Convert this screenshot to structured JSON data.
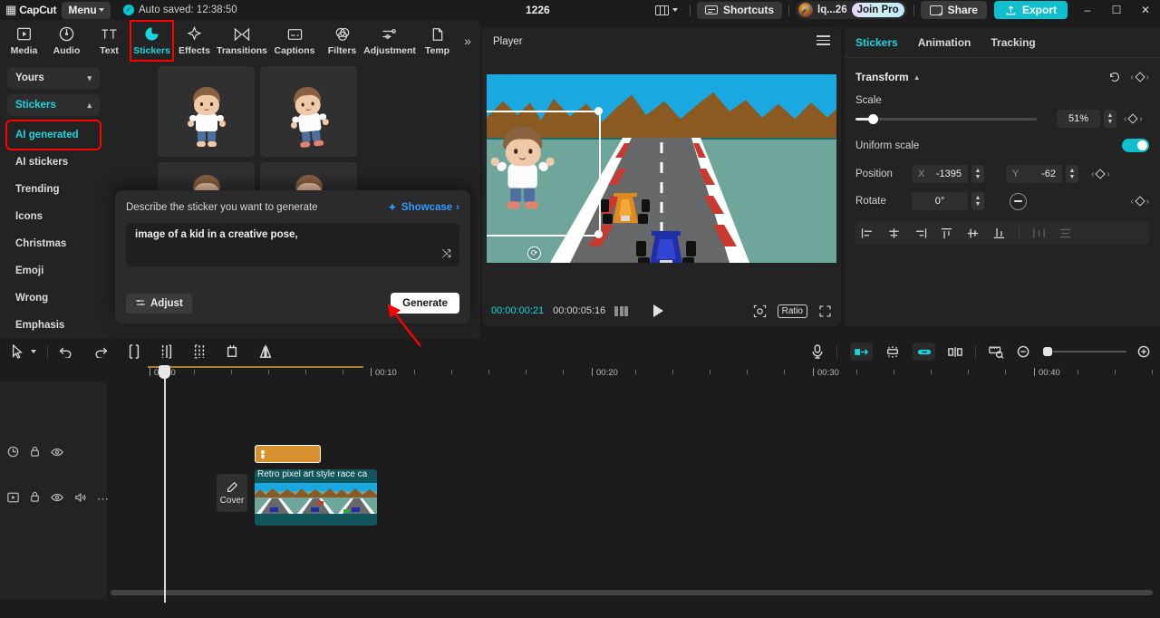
{
  "titlebar": {
    "app_name": "CapCut",
    "menu_label": "Menu",
    "autosave_text": "Auto saved: 12:38:50",
    "project_name": "1226",
    "shortcuts_label": "Shortcuts",
    "account_name": "lq...26",
    "join_pro_label": "Join Pro",
    "share_label": "Share",
    "export_label": "Export",
    "minimize": "–",
    "maximize": "☐",
    "close": "✕",
    "accent_teal": "#0fbfce"
  },
  "tooltabs": {
    "items": [
      {
        "label": "Media",
        "icon": "media-icon"
      },
      {
        "label": "Audio",
        "icon": "audio-icon"
      },
      {
        "label": "Text",
        "icon": "text-icon"
      },
      {
        "label": "Stickers",
        "icon": "stickers-icon"
      },
      {
        "label": "Effects",
        "icon": "effects-icon"
      },
      {
        "label": "Transitions",
        "icon": "transitions-icon"
      },
      {
        "label": "Captions",
        "icon": "captions-icon"
      },
      {
        "label": "Filters",
        "icon": "filters-icon"
      },
      {
        "label": "Adjustment",
        "icon": "adjustment-icon"
      },
      {
        "label": "Temp",
        "icon": "template-icon"
      }
    ],
    "active": "Stickers",
    "highlight_color": "#ff0000",
    "more_glyph": "»"
  },
  "categories": {
    "yours_label": "Yours",
    "stickers_label": "Stickers",
    "items": [
      {
        "label": "AI generated",
        "selected": true
      },
      {
        "label": "AI stickers",
        "selected": false
      },
      {
        "label": "Trending",
        "selected": false
      },
      {
        "label": "Icons",
        "selected": false
      },
      {
        "label": "Christmas",
        "selected": false
      },
      {
        "label": "Emoji",
        "selected": false
      },
      {
        "label": "Wrong",
        "selected": false
      },
      {
        "label": "Emphasis",
        "selected": false
      }
    ]
  },
  "sticker_grid": {
    "cells": [
      "kid-standing-sticker",
      "kid-walking-sticker",
      "kid-sticker-3",
      "kid-sticker-4"
    ]
  },
  "ai_panel": {
    "prompt_label": "Describe the sticker you want to generate",
    "showcase_label": "Showcase",
    "showcase_chevron": "›",
    "prompt_value": "image of a kid in a creative pose,",
    "prompt_placeholder": "Describe the sticker you want to generate",
    "shuffle_glyph": "⤨",
    "adjust_label": "Adjust",
    "generate_label": "Generate"
  },
  "player": {
    "title": "Player",
    "current_time": "00:00:00:21",
    "total_time": "00:00:05:16",
    "ratio_label": "Ratio",
    "play_icon": "play-icon",
    "frames_icon": "frames-icon",
    "crop_icon": "crop-zoom-icon",
    "fullscreen_icon": "fullscreen-icon"
  },
  "inspector": {
    "tabs": [
      {
        "label": "Stickers",
        "active": true
      },
      {
        "label": "Animation",
        "active": false
      },
      {
        "label": "Tracking",
        "active": false
      }
    ],
    "transform": {
      "section_title": "Transform",
      "scale_label": "Scale",
      "scale_value": "51%",
      "scale_percent": 51,
      "uniform_scale_label": "Uniform scale",
      "uniform_scale_on": true,
      "position_label": "Position",
      "x_label": "X",
      "x_value": "-1395",
      "y_label": "Y",
      "y_value": "-62",
      "rotate_label": "Rotate",
      "rotate_value": "0°",
      "reset_icon": "reset-icon"
    },
    "align_icons": [
      "align-left-icon",
      "align-center-h-icon",
      "align-right-icon",
      "align-top-icon",
      "align-center-v-icon",
      "align-bottom-icon",
      "distribute-h-icon",
      "distribute-v-icon"
    ]
  },
  "timeline": {
    "toolbar_left": [
      "select-tool-icon",
      "select-dropdown-icon",
      "undo-icon",
      "redo-icon",
      "split-icon",
      "trim-left-icon",
      "trim-right-icon",
      "crop-icon",
      "mirror-icon"
    ],
    "toolbar_right": [
      "microphone-icon",
      "snap-left-icon",
      "magnet-icon",
      "link-icon",
      "keyframe-icon",
      "preview-render-icon",
      "zoom-out-icon",
      "zoom-in-icon"
    ],
    "ruler_labels": [
      "00:00",
      "00:10",
      "00:20",
      "00:30",
      "00:40"
    ],
    "sticker_clip_label": "",
    "video_clip_title": "Retro pixel art style race ca",
    "cover_label": "Cover",
    "track_header_icons_top": [
      "clock-icon",
      "lock-icon",
      "eye-icon"
    ],
    "track_header_icons_main": [
      "video-track-icon",
      "lock-icon",
      "eye-icon",
      "volume-icon",
      "more-icon"
    ]
  }
}
